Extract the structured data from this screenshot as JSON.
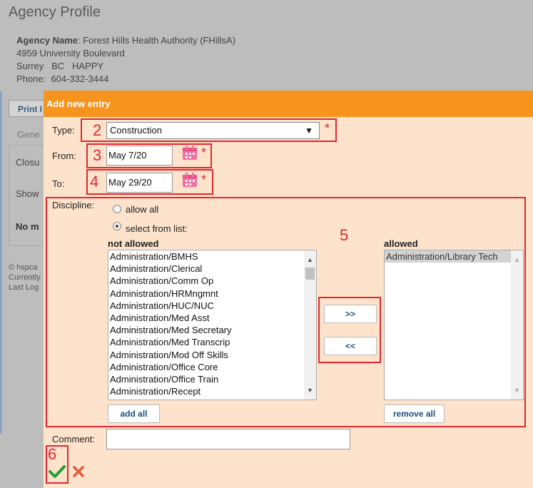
{
  "background": {
    "page_title": "Agency Profile",
    "agency_name_label": "Agency Name",
    "agency_name": ": Forest Hills Health Authority (FHillsA)",
    "address": "4959 University Boulevard",
    "city_line": "Surrey   BC   HAPPY",
    "phone_label": "Phone:",
    "phone": "604-332-3444",
    "print_button": "Print I",
    "general_tab": "Gene",
    "closure_label": "Closu",
    "show_label": "Show",
    "no_label": "No m",
    "footer_1": "© hspca",
    "footer_2": "Currently",
    "footer_3": "Last Log"
  },
  "dialog": {
    "title": "Add new entry",
    "type_label": "Type:",
    "type_value": "Construction",
    "from_label": "From:",
    "from_value": "May 7/20",
    "to_label": "To:",
    "to_value": "May 29/20",
    "required_marker": "*",
    "discipline_label": "Discipline:",
    "allow_all_label": "allow all",
    "select_from_list_label": "select from list:",
    "not_allowed_header": "not allowed",
    "allowed_header": "allowed",
    "not_allowed_items": [
      "Administration/BMHS",
      "Administration/Clerical",
      "Administration/Comm Op",
      "Administration/HRMngmnt",
      "Administration/HUC/NUC",
      "Administration/Med Asst",
      "Administration/Med Secretary",
      "Administration/Med Transcrip",
      "Administration/Mod Off Skills",
      "Administration/Office Core",
      "Administration/Office Train",
      "Administration/Recept"
    ],
    "allowed_items": [
      "Administration/Library Tech"
    ],
    "move_right_button": ">>",
    "move_left_button": "<<",
    "add_all_button": "add all",
    "remove_all_button": "remove all",
    "comment_label": "Comment:",
    "comment_value": ""
  },
  "annotations": {
    "type": "2",
    "from": "3",
    "to": "4",
    "discipline": "5",
    "save": "6"
  },
  "colors": {
    "header_orange": "#f7941d",
    "dialog_bg": "#fde3cb",
    "annotation_red": "#e3262e",
    "save_green": "#1e9e3a",
    "cancel_red": "#e05a3a",
    "calendar_pink": "#f26fa0"
  }
}
